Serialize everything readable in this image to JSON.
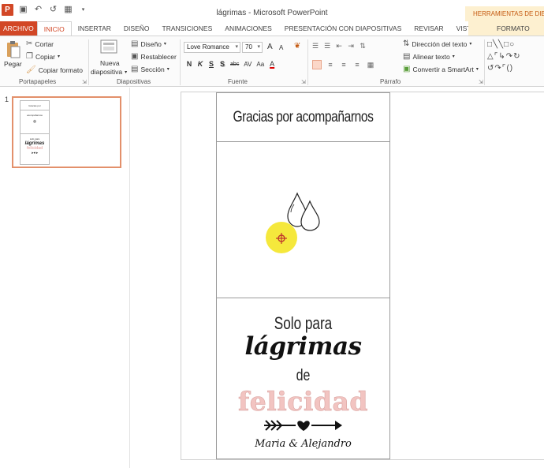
{
  "window": {
    "title": "lágrimas - Microsoft PowerPoint",
    "context_group": "HERRAMIENTAS DE DIBUJO"
  },
  "qat": {
    "app_icon": "P",
    "icons": [
      "save-icon",
      "undo-icon",
      "redo-icon",
      "start-from-beginning-icon"
    ]
  },
  "tabs": [
    {
      "label": "ARCHIVO"
    },
    {
      "label": "INICIO"
    },
    {
      "label": "INSERTAR"
    },
    {
      "label": "DISEÑO"
    },
    {
      "label": "TRANSICIONES"
    },
    {
      "label": "ANIMACIONES"
    },
    {
      "label": "PRESENTACIÓN CON DIAPOSITIVAS"
    },
    {
      "label": "REVISAR"
    },
    {
      "label": "VISTA"
    },
    {
      "label": "FORMATO"
    }
  ],
  "ribbon": {
    "clipboard": {
      "paste": "Pegar",
      "cut": "Cortar",
      "copy": "Copiar",
      "format_painter": "Copiar formato",
      "label": "Portapapeles"
    },
    "slides": {
      "new_slide_1": "Nueva",
      "new_slide_2": "diapositiva",
      "layout": "Diseño",
      "reset": "Restablecer",
      "section": "Sección",
      "label": "Diapositivas"
    },
    "font": {
      "font_name": "Love Romance",
      "font_size": "70",
      "label": "Fuente",
      "bold": "N",
      "italic": "K",
      "underline": "S",
      "shadow": "S",
      "strike": "abc",
      "spacing": "AV",
      "case": "Aa",
      "color": "A",
      "grow": "A",
      "shrink": "A"
    },
    "paragraph": {
      "text_direction": "Dirección del texto",
      "align_text": "Alinear texto",
      "smartart": "Convertir a SmartArt",
      "label": "Párrafo"
    }
  },
  "thumbnails": [
    {
      "number": "1",
      "mini_header": "Gracias por acompañarnos",
      "mini_line1": "solo para",
      "mini_line2": "lágrimas",
      "mini_line3": "felicidad"
    }
  ],
  "card": {
    "header": "Gracias por acompañarnos",
    "line1": "Solo para",
    "line2": "lágrimas",
    "line3": "de",
    "line4": "felicidad",
    "names": "Maria & Alejandro"
  },
  "colors": {
    "accent": "#d24726",
    "pink_text": "#f2c4c1",
    "highlight": "#f4e62b"
  }
}
